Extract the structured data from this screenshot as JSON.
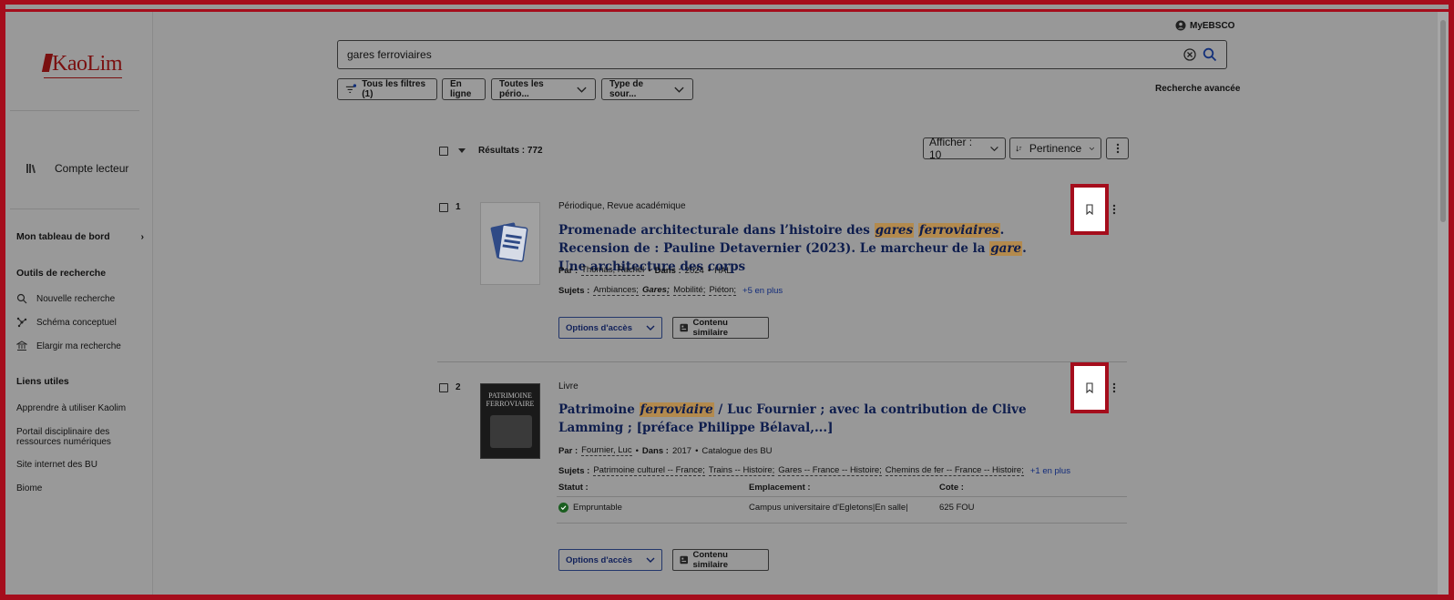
{
  "sidebar": {
    "logo_text": "KaoLim",
    "account_label": "Compte lecteur",
    "dashboard_label": "Mon tableau de bord",
    "search_tools_heading": "Outils de recherche",
    "tools": [
      {
        "label": "Nouvelle recherche",
        "icon": "search-icon"
      },
      {
        "label": "Schéma conceptuel",
        "icon": "concept-map-icon"
      },
      {
        "label": "Elargir ma recherche",
        "icon": "bank-icon"
      }
    ],
    "useful_links_heading": "Liens utiles",
    "links": [
      "Apprendre à utiliser Kaolim",
      "Portail disciplinaire des ressources numériques",
      "Site internet des BU",
      "Biome"
    ]
  },
  "header": {
    "myebsco_label": "MyEBSCO",
    "search_value": "gares ferroviaires",
    "filters": [
      {
        "label": "Tous les filtres (1)",
        "icon": "filter-icon"
      },
      {
        "label": "En ligne"
      },
      {
        "label": "Toutes les pério..."
      },
      {
        "label": "Type de sour..."
      }
    ],
    "advanced_search_label": "Recherche avancée"
  },
  "results_bar": {
    "results_label": "Résultats : 772",
    "display_label": "Afficher : 10",
    "sort_label": "Pertinence"
  },
  "results": [
    {
      "number": "1",
      "type": "Périodique, Revue académique",
      "title_parts": [
        {
          "t": "Promenade architecturale dans l’histoire des "
        },
        {
          "t": "gares",
          "hl": true
        },
        {
          "t": " "
        },
        {
          "t": "ferroviaires",
          "hl": true
        },
        {
          "t": ". Recension de : Pauline Detavernier (2023). Le marcheur de la "
        },
        {
          "t": "gare",
          "hl": true
        },
        {
          "t": ". Une architecture des corps"
        }
      ],
      "by_label": "Par :",
      "author": "Thomas, Rachel",
      "in_label": "Dans :",
      "year": "2024",
      "source": "HAL",
      "subjects_label": "Sujets :",
      "subjects": [
        "Ambiances;",
        "Gares;",
        "Mobilité;",
        "Piéton;"
      ],
      "more_subjects": "+5 en plus",
      "access_label": "Options d'accès",
      "similar_label": "Contenu similaire"
    },
    {
      "number": "2",
      "type": "Livre",
      "title_parts": [
        {
          "t": "Patrimoine "
        },
        {
          "t": "ferroviaire",
          "hl": true
        },
        {
          "t": " / Luc Fournier ; avec la contribution de Clive Lamming ; [préface Philippe Bélaval,...]"
        }
      ],
      "thumb_text": "PATRIMOINE FERROVIAIRE",
      "by_label": "Par :",
      "author": "Fournier, Luc",
      "in_label": "Dans :",
      "year": "2017",
      "source": "Catalogue des BU",
      "subjects_label": "Sujets :",
      "subjects": [
        "Patrimoine culturel -- France;",
        "Trains -- Histoire;",
        "Gares -- France -- Histoire;",
        "Chemins de fer -- France -- Histoire;"
      ],
      "more_subjects": "+1 en plus",
      "availability": {
        "headers": [
          "Statut :",
          "Emplacement :",
          "Cote :"
        ],
        "status": "Empruntable",
        "location": "Campus universitaire d'Egletons|En salle|",
        "call_number": "625 FOU"
      },
      "access_label": "Options d'accès",
      "similar_label": "Contenu similaire"
    }
  ],
  "colors": {
    "highlight_frame": "#a50d1c",
    "title_blue": "#0e1d4d",
    "term_highlight": "#b38a4d"
  }
}
